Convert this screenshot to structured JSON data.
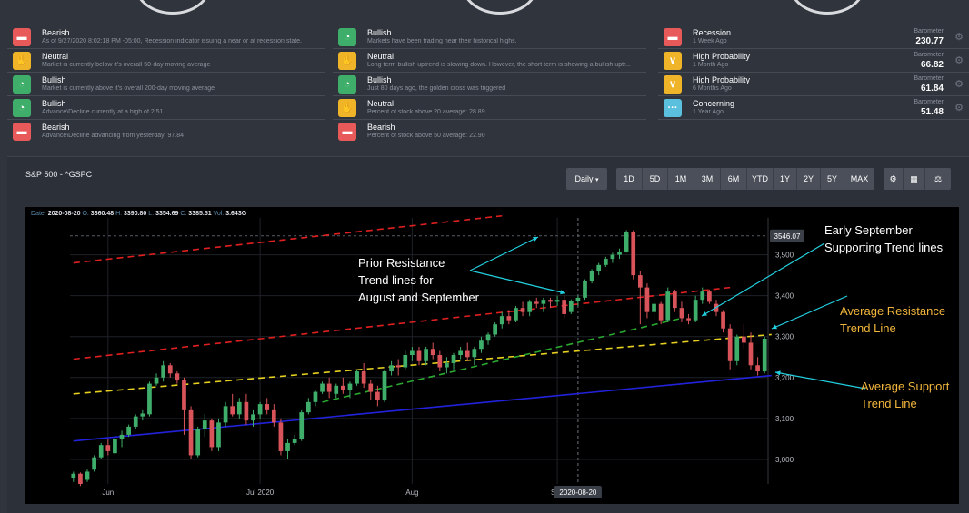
{
  "indicators_col1": [
    {
      "title": "Bearish",
      "desc": "As of 9/27/2020 8:02:18 PM -05:00, Recession indicator issuing a near or at recession state.",
      "color": "#e85a5a",
      "icon": "chat-icon"
    },
    {
      "title": "Neutral",
      "desc": "Market is currently below it's overall 50-day moving average",
      "color": "#f0b429",
      "icon": "hand-icon"
    },
    {
      "title": "Bullish",
      "desc": "Market is currently above it's overall 200-day moving average",
      "color": "#3fae6a",
      "icon": "gauge-icon"
    },
    {
      "title": "Bullish",
      "desc": "Advance\\Decline currently at a high of 2.51",
      "color": "#3fae6a",
      "icon": "gauge-icon"
    },
    {
      "title": "Bearish",
      "desc": "Advance\\Decline advancing from yesterday: 97.84",
      "color": "#e85a5a",
      "icon": "chat-icon"
    }
  ],
  "indicators_col2": [
    {
      "title": "Bullish",
      "desc": "Markets have been trading near their historical highs.",
      "color": "#3fae6a",
      "icon": "gauge-icon"
    },
    {
      "title": "Neutral",
      "desc": "Long term bullish uptrend is slowing down. However, the short term is showing a bullish uptr...",
      "color": "#f0b429",
      "icon": "hand-icon"
    },
    {
      "title": "Bullish",
      "desc": "Just 80 days ago, the golden cross was triggered",
      "color": "#3fae6a",
      "icon": "gauge-icon"
    },
    {
      "title": "Neutral",
      "desc": "Percent of stock above 20 average: 28.89",
      "color": "#f0b429",
      "icon": "hand-icon"
    },
    {
      "title": "Bearish",
      "desc": "Percent of stock above 50 average: 22.90",
      "color": "#e85a5a",
      "icon": "chat-icon"
    }
  ],
  "barometers": [
    {
      "title": "Recession",
      "desc": "1 Week Ago",
      "label": "Barometer",
      "value": "230.77",
      "color": "#e85a5a",
      "icon": "chat-icon"
    },
    {
      "title": "High Probability",
      "desc": "1 Month Ago",
      "label": "Barometer",
      "value": "66.82",
      "color": "#f0b429",
      "icon": "chevron-icon"
    },
    {
      "title": "High Probability",
      "desc": "6 Months Ago",
      "label": "Barometer",
      "value": "61.84",
      "color": "#f0b429",
      "icon": "chevron-icon"
    },
    {
      "title": "Concerning",
      "desc": "1 Year Ago",
      "label": "Barometer",
      "value": "51.48",
      "color": "#5bc0de",
      "icon": "dots-icon"
    }
  ],
  "chart_panel": {
    "title": "S&P 500 - ^GSPC",
    "interval": "Daily",
    "ranges": [
      "1D",
      "5D",
      "1M",
      "3M",
      "6M",
      "YTD",
      "1Y",
      "2Y",
      "5Y",
      "MAX"
    ],
    "tool_icons": [
      "settings-icon",
      "calculator-icon",
      "compare-icon"
    ]
  },
  "info": {
    "date_label": "Date:",
    "date": "2020-08-20",
    "o_label": "O:",
    "o": "3360.48",
    "h_label": "H:",
    "h": "3390.80",
    "l_label": "L:",
    "l": "3354.69",
    "c_label": "C:",
    "c": "3385.51",
    "vol_label": "Vol:",
    "vol": "3.643G"
  },
  "annotations": {
    "prior_resistance": [
      "Prior Resistance",
      "Trend lines for",
      "August and September"
    ],
    "early_sept": [
      "Early September",
      "Supporting Trend lines"
    ],
    "avg_resistance": [
      "Average Resistance",
      "Trend Line"
    ],
    "avg_support": [
      "Average Support",
      "Trend Line"
    ]
  },
  "chart_data": {
    "type": "candlestick",
    "title": "S&P 500 - ^GSPC",
    "x_tick_labels": [
      "Jun",
      "Jul 2020",
      "Aug",
      "Sep"
    ],
    "y_tick_labels": [
      "3,000",
      "3,100",
      "3,200",
      "3,300",
      "3,400",
      "3,500"
    ],
    "y_ticks": [
      3000,
      3100,
      3200,
      3300,
      3400,
      3500
    ],
    "ylim": [
      2940,
      3590
    ],
    "price_marker": "3546.07",
    "price_marker_value": 3546.07,
    "crosshair_label": "2020-08-20",
    "crosshair_value": 3385.51,
    "grid": true,
    "colors": {
      "up": "#3fae6a",
      "down": "#d9545a",
      "bg": "#000000"
    },
    "candles": [
      [
        2955,
        2970,
        2945,
        2965
      ],
      [
        2965,
        2968,
        2935,
        2940
      ],
      [
        2950,
        2975,
        2945,
        2970
      ],
      [
        2975,
        3010,
        2970,
        3005
      ],
      [
        3005,
        3040,
        3000,
        3035
      ],
      [
        3035,
        3050,
        3010,
        3020
      ],
      [
        3015,
        3055,
        3010,
        3050
      ],
      [
        3050,
        3070,
        3030,
        3060
      ],
      [
        3060,
        3085,
        3055,
        3080
      ],
      [
        3080,
        3110,
        3075,
        3105
      ],
      [
        3105,
        3120,
        3095,
        3112
      ],
      [
        3110,
        3190,
        3105,
        3185
      ],
      [
        3185,
        3210,
        3180,
        3200
      ],
      [
        3200,
        3240,
        3190,
        3230
      ],
      [
        3230,
        3235,
        3200,
        3210
      ],
      [
        3210,
        3215,
        3185,
        3195
      ],
      [
        3195,
        3200,
        3060,
        3120
      ],
      [
        3120,
        3130,
        3000,
        3010
      ],
      [
        3010,
        3080,
        3005,
        3075
      ],
      [
        3075,
        3110,
        3055,
        3095
      ],
      [
        3095,
        3100,
        3020,
        3030
      ],
      [
        3030,
        3100,
        3020,
        3090
      ],
      [
        3090,
        3140,
        3080,
        3130
      ],
      [
        3130,
        3160,
        3105,
        3110
      ],
      [
        3110,
        3150,
        3100,
        3140
      ],
      [
        3140,
        3160,
        3085,
        3095
      ],
      [
        3095,
        3120,
        3080,
        3110
      ],
      [
        3110,
        3140,
        3100,
        3135
      ],
      [
        3135,
        3150,
        3110,
        3120
      ],
      [
        3120,
        3135,
        3080,
        3090
      ],
      [
        3090,
        3100,
        3010,
        3020
      ],
      [
        3020,
        3050,
        3000,
        3040
      ],
      [
        3040,
        3060,
        3035,
        3050
      ],
      [
        3050,
        3120,
        3045,
        3115
      ],
      [
        3115,
        3150,
        3110,
        3140
      ],
      [
        3140,
        3170,
        3130,
        3165
      ],
      [
        3165,
        3190,
        3160,
        3185
      ],
      [
        3185,
        3200,
        3150,
        3165
      ],
      [
        3160,
        3185,
        3150,
        3180
      ],
      [
        3180,
        3200,
        3160,
        3170
      ],
      [
        3170,
        3190,
        3150,
        3185
      ],
      [
        3185,
        3220,
        3180,
        3215
      ],
      [
        3215,
        3235,
        3175,
        3185
      ],
      [
        3185,
        3195,
        3145,
        3165
      ],
      [
        3165,
        3180,
        3130,
        3145
      ],
      [
        3145,
        3220,
        3140,
        3215
      ],
      [
        3215,
        3240,
        3205,
        3230
      ],
      [
        3230,
        3245,
        3205,
        3225
      ],
      [
        3225,
        3265,
        3220,
        3255
      ],
      [
        3255,
        3275,
        3240,
        3265
      ],
      [
        3265,
        3275,
        3230,
        3240
      ],
      [
        3240,
        3275,
        3230,
        3270
      ],
      [
        3270,
        3285,
        3245,
        3255
      ],
      [
        3255,
        3265,
        3215,
        3225
      ],
      [
        3225,
        3250,
        3210,
        3235
      ],
      [
        3235,
        3260,
        3220,
        3255
      ],
      [
        3255,
        3275,
        3245,
        3265
      ],
      [
        3265,
        3285,
        3240,
        3250
      ],
      [
        3250,
        3275,
        3230,
        3270
      ],
      [
        3270,
        3300,
        3260,
        3290
      ],
      [
        3290,
        3310,
        3280,
        3305
      ],
      [
        3305,
        3335,
        3300,
        3330
      ],
      [
        3330,
        3360,
        3320,
        3350
      ],
      [
        3350,
        3365,
        3330,
        3340
      ],
      [
        3340,
        3375,
        3335,
        3370
      ],
      [
        3370,
        3385,
        3350,
        3360
      ],
      [
        3360,
        3390,
        3350,
        3385
      ],
      [
        3385,
        3395,
        3370,
        3380
      ],
      [
        3380,
        3395,
        3360,
        3390
      ],
      [
        3390,
        3395,
        3370,
        3385
      ],
      [
        3385,
        3400,
        3375,
        3390
      ],
      [
        3390,
        3400,
        3345,
        3355
      ],
      [
        3360,
        3391,
        3355,
        3386
      ],
      [
        3386,
        3400,
        3375,
        3395
      ],
      [
        3395,
        3440,
        3390,
        3435
      ],
      [
        3435,
        3465,
        3430,
        3460
      ],
      [
        3460,
        3480,
        3450,
        3475
      ],
      [
        3475,
        3495,
        3470,
        3490
      ],
      [
        3490,
        3505,
        3480,
        3500
      ],
      [
        3500,
        3515,
        3490,
        3508
      ],
      [
        3508,
        3560,
        3505,
        3555
      ],
      [
        3555,
        3560,
        3440,
        3450
      ],
      [
        3450,
        3460,
        3330,
        3420
      ],
      [
        3420,
        3430,
        3345,
        3360
      ],
      [
        3360,
        3400,
        3340,
        3380
      ],
      [
        3380,
        3385,
        3330,
        3340
      ],
      [
        3340,
        3420,
        3335,
        3410
      ],
      [
        3410,
        3415,
        3360,
        3370
      ],
      [
        3370,
        3385,
        3335,
        3345
      ],
      [
        3345,
        3355,
        3330,
        3340
      ],
      [
        3340,
        3400,
        3335,
        3390
      ],
      [
        3390,
        3420,
        3380,
        3410
      ],
      [
        3410,
        3415,
        3380,
        3385
      ],
      [
        3380,
        3390,
        3350,
        3360
      ],
      [
        3360,
        3365,
        3310,
        3320
      ],
      [
        3320,
        3330,
        3220,
        3240
      ],
      [
        3240,
        3305,
        3230,
        3300
      ],
      [
        3300,
        3330,
        3270,
        3285
      ],
      [
        3285,
        3310,
        3220,
        3230
      ],
      [
        3230,
        3250,
        3205,
        3215
      ],
      [
        3215,
        3300,
        3210,
        3295
      ]
    ],
    "trendlines": [
      {
        "name": "Prior resistance (upper)",
        "color": "#e02020",
        "dash": true,
        "from": [
          0,
          3480
        ],
        "to": [
          62,
          3595
        ]
      },
      {
        "name": "Prior resistance (lower)",
        "color": "#e02020",
        "dash": true,
        "from": [
          0,
          3245
        ],
        "to": [
          95,
          3420
        ]
      },
      {
        "name": "Average resistance",
        "color": "#e6d020",
        "dash": true,
        "from": [
          0,
          3160
        ],
        "to": [
          101,
          3305
        ]
      },
      {
        "name": "Early September support",
        "color": "#2aa830",
        "dash": true,
        "from": [
          36,
          3140
        ],
        "to": [
          88,
          3345
        ]
      },
      {
        "name": "Average support",
        "color": "#2222dd",
        "dash": false,
        "from": [
          0,
          3045
        ],
        "to": [
          101,
          3205
        ]
      }
    ]
  }
}
